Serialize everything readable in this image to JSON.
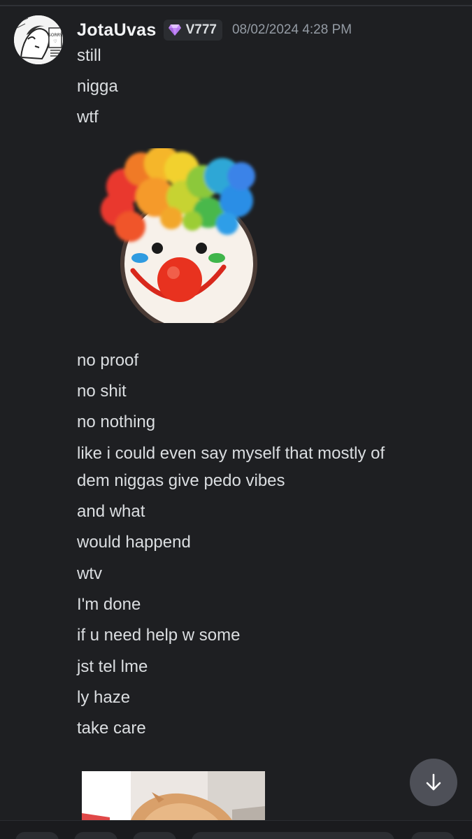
{
  "message": {
    "username": "JotaUvas",
    "role_tag": "V777",
    "timestamp": "08/02/2024 4:28 PM",
    "lines_before_sticker": [
      "still",
      "nigga",
      "wtf"
    ],
    "lines_after_sticker": [
      "no proof",
      "no shit",
      "no nothing",
      "like i could even say myself that mostly of",
      "dem niggas give pedo vibes",
      "and what",
      "would happend",
      "wtv",
      "I'm done",
      "if u need help w some",
      "jst tel lme",
      "ly haze",
      "take care"
    ]
  },
  "icons": {
    "role_gem": "gem-icon",
    "sticker": "clown-face-emoji",
    "scroll_down": "arrow-down-icon"
  },
  "colors": {
    "background": "#1e1f22",
    "text": "#dbdee1",
    "username": "#f2f3f5",
    "timestamp": "#949ba4",
    "role_tag_bg": "#2b2d31",
    "gem": "#c58af9"
  }
}
